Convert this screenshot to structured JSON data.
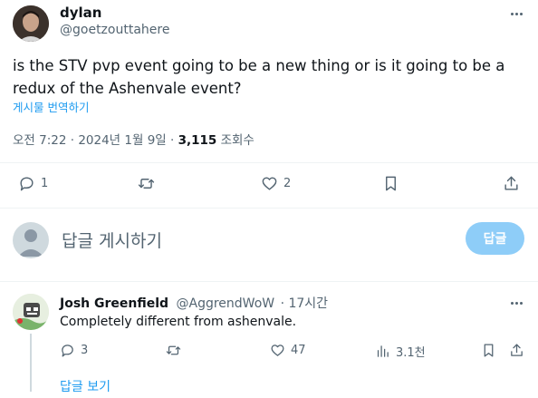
{
  "tweet": {
    "author_name": "dylan",
    "author_handle": "@goetzouttahere",
    "text": "is the STV pvp event going to be a new thing or is it going to be a redux of the Ashenvale event?",
    "translate_label": "게시물 번역하기",
    "timestamp": "오전 7:22 · 2024년 1월 9일 · ",
    "views_count": "3,115",
    "views_label": " 조회수",
    "reply_count": "1",
    "like_count": "2"
  },
  "composer": {
    "placeholder": "답글 게시하기",
    "submit_label": "답글"
  },
  "reply": {
    "author_name": "Josh Greenfield",
    "author_handle": "@AggrendWoW",
    "time": "· 17시간",
    "text": "Completely different from ashenvale.",
    "reply_count": "3",
    "like_count": "47",
    "views_count": "3.1천",
    "show_replies_label": "답글 보기"
  },
  "colors": {
    "accent": "#1d9bf0",
    "accent_disabled": "#8ecdf8",
    "muted": "#536471",
    "divider": "#eff3f4"
  }
}
